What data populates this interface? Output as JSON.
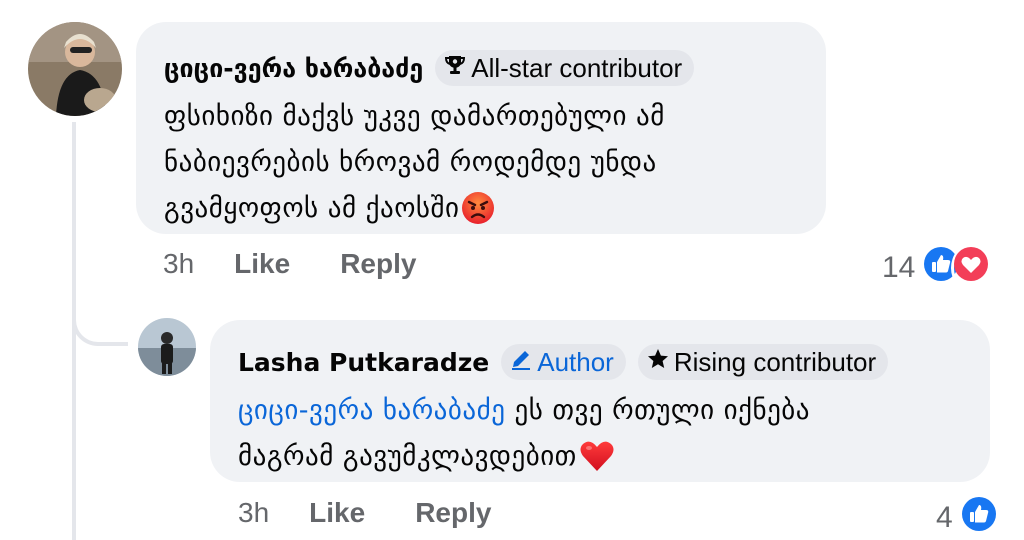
{
  "comments": [
    {
      "author": "ციცი-ვერა ხარაბაძე",
      "badges": [
        {
          "label": "All-star contributor",
          "icon": "trophy-icon"
        }
      ],
      "text_lines": [
        "ფსიხიზი მაქვს უკვე დამართებული ამ",
        "ნაბიევრების ხროვამ როდემდე უნდა",
        "გვამყოფოს ამ ქაოსში"
      ],
      "emoji": "angry-face-icon",
      "time": "3h",
      "like_label": "Like",
      "reply_label": "Reply",
      "reaction_count": "14",
      "reactions": [
        "like-icon",
        "love-icon"
      ]
    },
    {
      "author": "Lasha Putkaradze",
      "badges": [
        {
          "label": "Author",
          "icon": "pencil-icon"
        },
        {
          "label": "Rising contributor",
          "icon": "star-icon"
        }
      ],
      "mention": "ციცი-ვერა ხარაბაძე",
      "text_first": " ეს თვე რთული იქნება",
      "text_second": "მაგრამ გავუმკლავდებით",
      "emoji": "red-heart-icon",
      "time": "3h",
      "like_label": "Like",
      "reply_label": "Reply",
      "reaction_count": "4",
      "reactions": [
        "like-icon"
      ]
    }
  ],
  "colors": {
    "bubble": "#f0f2f5",
    "badge": "#e4e6eb",
    "link": "#0a66d8",
    "secondary_text": "#65676b",
    "like_blue": "#1877f2",
    "love_red": "#f33e58"
  }
}
